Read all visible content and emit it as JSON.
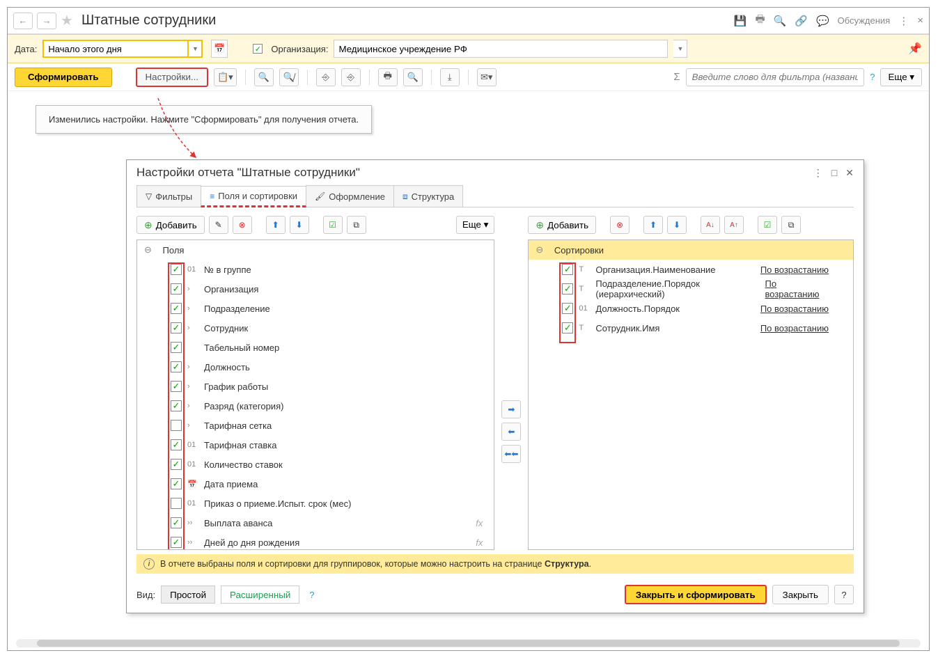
{
  "header": {
    "title": "Штатные сотрудники",
    "discuss": "Обсуждения"
  },
  "filters": {
    "date_label": "Дата:",
    "date_value": "Начало этого дня",
    "org_label": "Организация:",
    "org_value": "Медицинское учреждение РФ"
  },
  "toolbar": {
    "generate": "Сформировать",
    "settings": "Настройки...",
    "filter_placeholder": "Введите слово для фильтра (название товара, покупателя и пр.)",
    "more": "Еще"
  },
  "message": "Изменились настройки. Нажмите \"Сформировать\" для получения отчета.",
  "dialog": {
    "title": "Настройки отчета \"Штатные сотрудники\"",
    "tabs": {
      "filters": "Фильтры",
      "fields": "Поля и сортировки",
      "appearance": "Оформление",
      "structure": "Структура"
    },
    "add": "Добавить",
    "more": "Еще",
    "fields_header": "Поля",
    "fields": [
      {
        "checked": true,
        "type": "01",
        "label": "№ в группе"
      },
      {
        "checked": true,
        "type": "›",
        "label": "Организация"
      },
      {
        "checked": true,
        "type": "›",
        "label": "Подразделение"
      },
      {
        "checked": true,
        "type": "›",
        "label": "Сотрудник"
      },
      {
        "checked": true,
        "type": "",
        "label": "Табельный номер"
      },
      {
        "checked": true,
        "type": "›",
        "label": "Должность"
      },
      {
        "checked": true,
        "type": "›",
        "label": "График работы"
      },
      {
        "checked": true,
        "type": "›",
        "label": "Разряд (категория)"
      },
      {
        "checked": false,
        "type": "›",
        "label": "Тарифная сетка"
      },
      {
        "checked": true,
        "type": "01",
        "label": "Тарифная ставка"
      },
      {
        "checked": true,
        "type": "01",
        "label": "Количество ставок"
      },
      {
        "checked": true,
        "type": "📅",
        "label": "Дата приема"
      },
      {
        "checked": false,
        "type": "01",
        "label": "Приказ о приеме.Испыт. срок (мес)"
      },
      {
        "checked": true,
        "type": "››",
        "label": "Выплата аванса",
        "fx": true
      },
      {
        "checked": true,
        "type": "››",
        "label": "Дней до дня рождения",
        "fx": true
      }
    ],
    "sorts_header": "Сортировки",
    "sorts": [
      {
        "checked": true,
        "type": "T",
        "label": "Организация.Наименование",
        "dir": "По возрастанию"
      },
      {
        "checked": true,
        "type": "T",
        "label": "Подразделение.Порядок (иерархический)",
        "dir": "По возрастанию"
      },
      {
        "checked": true,
        "type": "01",
        "label": "Должность.Порядок",
        "dir": "По возрастанию"
      },
      {
        "checked": true,
        "type": "T",
        "label": "Сотрудник.Имя",
        "dir": "По возрастанию"
      }
    ],
    "info_text": "В отчете выбраны поля и сортировки для группировок, которые можно настроить на странице ",
    "info_bold": "Структура",
    "view_label": "Вид:",
    "view_simple": "Простой",
    "view_advanced": "Расширенный",
    "close_generate": "Закрыть и сформировать",
    "close": "Закрыть"
  }
}
